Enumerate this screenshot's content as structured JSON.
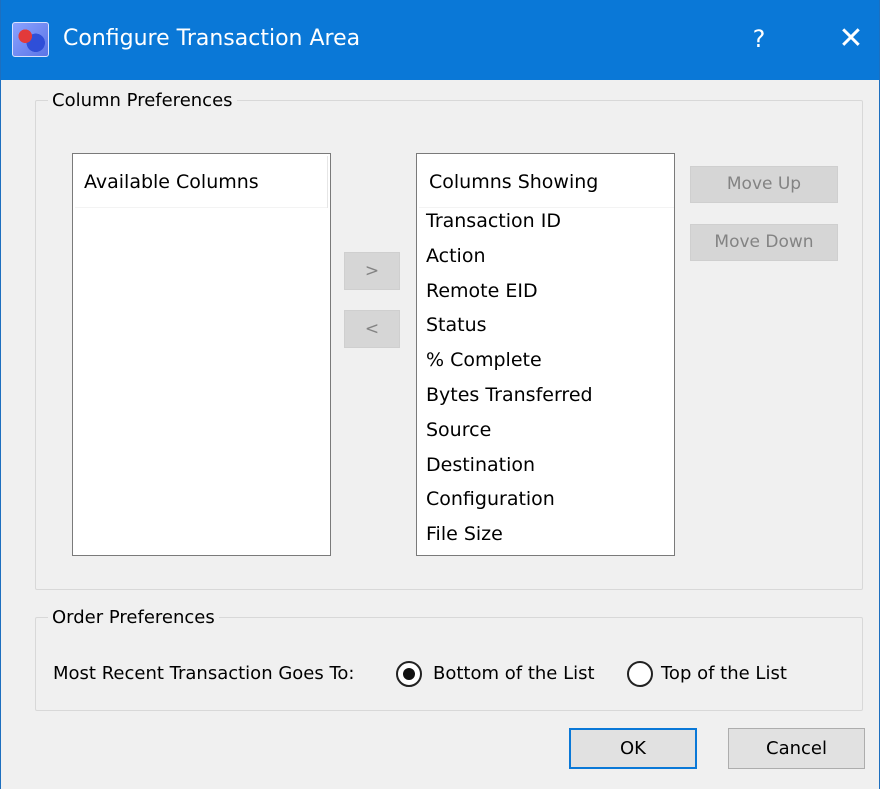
{
  "window": {
    "title": "Configure Transaction Area",
    "help_glyph": "?",
    "close_glyph": "✕",
    "colors": {
      "titlebar": "#0a78d7",
      "background": "#f0f0f0",
      "ok_border": "#0a78d7"
    }
  },
  "column_prefs": {
    "legend": "Column Preferences",
    "available": {
      "header": "Available Columns",
      "items": []
    },
    "showing": {
      "header": "Columns Showing",
      "items": [
        "Transaction ID",
        "Action",
        "Remote EID",
        "Status",
        "% Complete",
        "Bytes Transferred",
        "Source",
        "Destination",
        "Configuration",
        "File Size"
      ]
    },
    "add_label": ">",
    "remove_label": "<",
    "move_up_label": "Move Up",
    "move_down_label": "Move Down"
  },
  "order_prefs": {
    "legend": "Order Preferences",
    "prompt": "Most Recent Transaction Goes To:",
    "options": [
      {
        "label": "Bottom of the List",
        "selected": true
      },
      {
        "label": "Top of the List",
        "selected": false
      }
    ]
  },
  "buttons": {
    "ok": "OK",
    "cancel": "Cancel"
  }
}
